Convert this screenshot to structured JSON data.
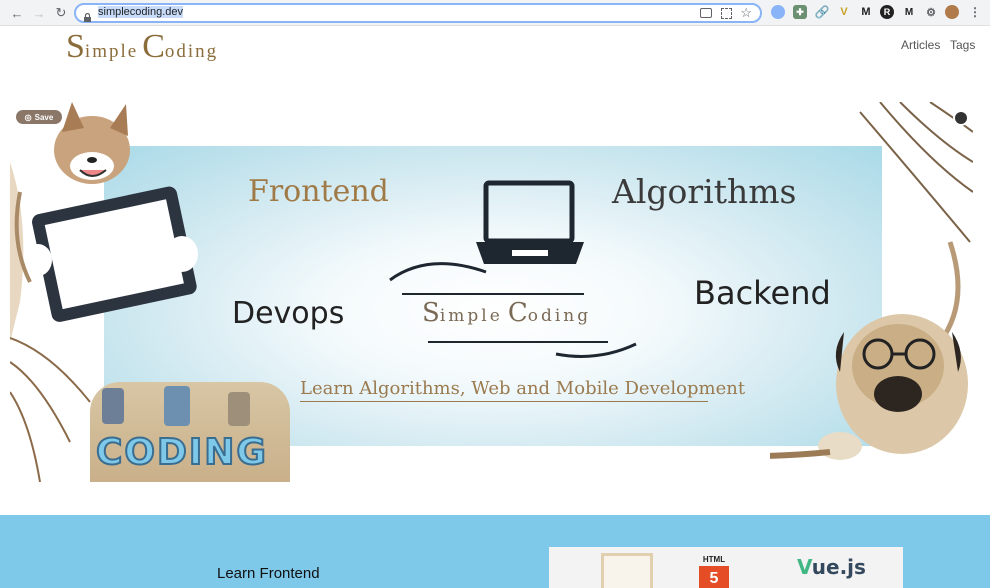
{
  "browser": {
    "url": "simplecoding.dev"
  },
  "site": {
    "logo_s": "S",
    "logo_imple": "imple",
    "logo_c": "C",
    "logo_oding": "oding",
    "nav": [
      "Articles",
      "Tags"
    ]
  },
  "hero": {
    "save_label": "Save",
    "frontend": "Frontend",
    "algorithms": "Algorithms",
    "devops": "Devops",
    "backend": "Backend",
    "brand_s": "S",
    "brand_imple": "imple",
    "brand_c": "C",
    "brand_oding": "oding",
    "tagline": "Learn Algorithms, Web and Mobile Development",
    "coding_letters": "CODING"
  },
  "section": {
    "title": "Learn Frontend",
    "html_badge": "HTML",
    "html_number": "5",
    "vue_label": "ue.js"
  },
  "colors": {
    "brand_gold": "#8a6d3b",
    "section_blue": "#7ec8ea",
    "omnibox_focus": "#8ab4f8"
  }
}
